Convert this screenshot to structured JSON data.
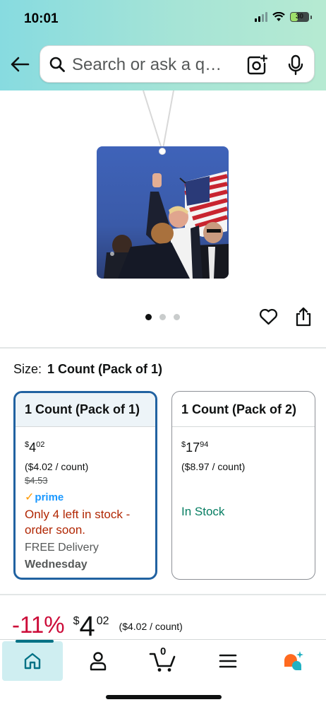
{
  "status_bar": {
    "time": "10:01",
    "battery": "30"
  },
  "search": {
    "placeholder": "Search or ask a q…"
  },
  "gallery": {
    "page_count": 3,
    "active_page": 1
  },
  "size": {
    "label": "Size:",
    "value": "1 Count (Pack of 1)"
  },
  "options": [
    {
      "title": "1 Count (Pack of 1)",
      "price_whole": "4",
      "price_frac": "02",
      "currency": "$",
      "unit_price": "($4.02 / count)",
      "list_price": "$4.53",
      "prime": "prime",
      "stock": "Only 4 left in stock - order soon.",
      "delivery": "FREE Delivery",
      "delivery_day": "Wednesday"
    },
    {
      "title": "1 Count (Pack of 2)",
      "price_whole": "17",
      "price_frac": "94",
      "currency": "$",
      "unit_price": "($8.97 / count)",
      "stock": "In Stock"
    }
  ],
  "price": {
    "discount": "-11%",
    "currency": "$",
    "whole": "4",
    "fraction": "02",
    "unit": "($4.02 / count)"
  },
  "nav": {
    "cart_count": "0"
  },
  "colors": {
    "accent": "#2162a1",
    "deal_red": "#cc0c39",
    "stock_red": "#b12704",
    "in_stock_green": "#067d62",
    "prime_blue": "#1a98ff"
  },
  "icons": [
    "back-arrow-icon",
    "search-icon",
    "camera-lens-icon",
    "microphone-icon",
    "heart-icon",
    "share-icon",
    "home-icon",
    "account-icon",
    "cart-icon",
    "menu-icon",
    "rufus-icon"
  ]
}
